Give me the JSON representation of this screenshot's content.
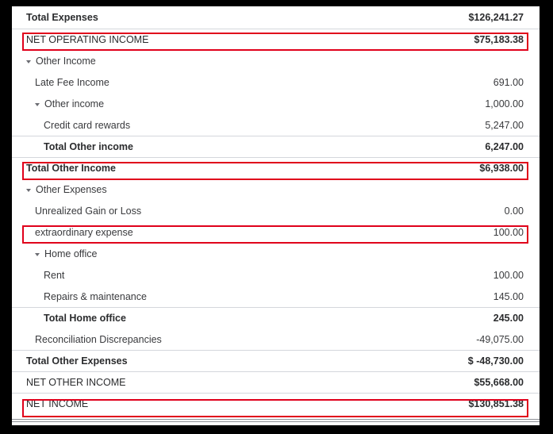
{
  "rows": [
    {
      "label": "Total Expenses",
      "value": "$126,241.27"
    },
    {
      "label": "NET OPERATING INCOME",
      "value": "$75,183.38"
    },
    {
      "label": "Other Income",
      "value": ""
    },
    {
      "label": "Late Fee Income",
      "value": "691.00"
    },
    {
      "label": "Other income",
      "value": "1,000.00"
    },
    {
      "label": "Credit card rewards",
      "value": "5,247.00"
    },
    {
      "label": "Total Other income",
      "value": "6,247.00"
    },
    {
      "label": "Total Other Income",
      "value": "$6,938.00"
    },
    {
      "label": "Other Expenses",
      "value": ""
    },
    {
      "label": "Unrealized Gain or Loss",
      "value": "0.00"
    },
    {
      "label": "extraordinary expense",
      "value": "100.00"
    },
    {
      "label": "Home office",
      "value": ""
    },
    {
      "label": "Rent",
      "value": "100.00"
    },
    {
      "label": "Repairs & maintenance",
      "value": "145.00"
    },
    {
      "label": "Total Home office",
      "value": "245.00"
    },
    {
      "label": "Reconciliation Discrepancies",
      "value": "-49,075.00"
    },
    {
      "label": "Total Other Expenses",
      "value": "$ -48,730.00"
    },
    {
      "label": "NET OTHER INCOME",
      "value": "$55,668.00"
    },
    {
      "label": "NET INCOME",
      "value": "$130,851.38"
    }
  ],
  "colors": {
    "highlight": "#e0001b",
    "text": "#393a3d",
    "background": "#000000",
    "sheet": "#ffffff"
  },
  "icons": {
    "expand": "caret-down-icon"
  }
}
